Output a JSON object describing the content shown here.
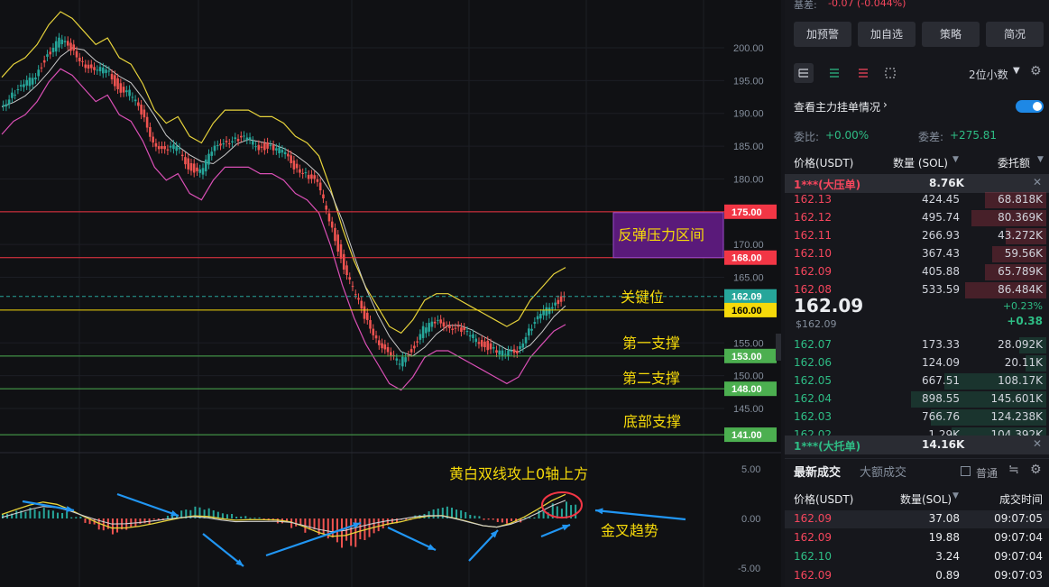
{
  "header": {
    "basis_label": "基差:",
    "basis_value": "-0.07 (-0.044%)"
  },
  "buttons": [
    "加预警",
    "加自选",
    "策略",
    "简况"
  ],
  "toolbar": {
    "decimals": "2位小数"
  },
  "orders_toggle": {
    "label": "查看主力挂单情况",
    "on": true
  },
  "stats": {
    "ratio_label": "委比:",
    "ratio_value": "+0.00%",
    "diff_label": "委差:",
    "diff_value": "+275.81"
  },
  "orderbook": {
    "headers": [
      "价格(USDT)",
      "数量 (SOL)",
      "委托额"
    ],
    "big_ask": {
      "label": "1***(大压单)",
      "qty": "8.76K"
    },
    "big_bid": {
      "label": "1***(大托单)",
      "qty": "14.16K"
    },
    "asks": [
      {
        "price": "162.13",
        "qty": "424.45",
        "amount": "68.818K",
        "fill": 0.45
      },
      {
        "price": "162.12",
        "qty": "495.74",
        "amount": "80.369K",
        "fill": 0.55
      },
      {
        "price": "162.11",
        "qty": "266.93",
        "amount": "43.272K",
        "fill": 0.3
      },
      {
        "price": "162.10",
        "qty": "367.43",
        "amount": "59.56K",
        "fill": 0.4
      },
      {
        "price": "162.09",
        "qty": "405.88",
        "amount": "65.789K",
        "fill": 0.45
      },
      {
        "price": "162.08",
        "qty": "533.59",
        "amount": "86.484K",
        "fill": 0.6
      }
    ],
    "mid": {
      "price": "162.09",
      "usd": "$162.09",
      "pct": "+0.23%",
      "change": "+0.38"
    },
    "bids": [
      {
        "price": "162.07",
        "qty": "173.33",
        "amount": "28.092K",
        "fill": 0.2
      },
      {
        "price": "162.06",
        "qty": "124.09",
        "amount": "20.11K",
        "fill": 0.15
      },
      {
        "price": "162.05",
        "qty": "667.51",
        "amount": "108.17K",
        "fill": 0.75
      },
      {
        "price": "162.04",
        "qty": "898.55",
        "amount": "145.601K",
        "fill": 1.0
      },
      {
        "price": "162.03",
        "qty": "766.76",
        "amount": "124.238K",
        "fill": 0.85
      },
      {
        "price": "162.02",
        "qty": "1.29K",
        "amount": "104.392K",
        "fill": 0.7
      }
    ]
  },
  "trades": {
    "tab_active": "最新成交",
    "tab_other": "大额成交",
    "filter_label": "普通",
    "headers": [
      "价格(USDT)",
      "数量(SOL)",
      "成交时间"
    ],
    "rows": [
      {
        "price": "162.09",
        "qty": "37.08",
        "time": "09:07:05",
        "side": "sell"
      },
      {
        "price": "162.09",
        "qty": "19.88",
        "time": "09:07:04",
        "side": "sell"
      },
      {
        "price": "162.10",
        "qty": "3.24",
        "time": "09:07:04",
        "side": "buy"
      },
      {
        "price": "162.09",
        "qty": "0.89",
        "time": "09:07:03",
        "side": "sell"
      }
    ]
  },
  "chart_data": {
    "type": "candlestick",
    "symbol_price_axis": [
      "200.00",
      "195.00",
      "190.00",
      "185.00",
      "180.00",
      "170.00",
      "165.00",
      "155.00",
      "150.00",
      "145.00"
    ],
    "macd_axis": [
      "5.00",
      "0.00",
      "-5.00"
    ],
    "ylim": [
      141,
      203
    ],
    "levels": [
      {
        "value": 175.0,
        "label": "175.00",
        "color": "#f23645"
      },
      {
        "value": 168.0,
        "label": "168.00",
        "color": "#f23645"
      },
      {
        "value": 162.09,
        "label": "162.09",
        "color": "#26a69a"
      },
      {
        "value": 160.0,
        "label": "160.00",
        "color": "#f5d90a"
      },
      {
        "value": 153.0,
        "label": "153.00",
        "color": "#4caf50"
      },
      {
        "value": 148.0,
        "label": "148.00",
        "color": "#4caf50"
      },
      {
        "value": 141.0,
        "label": "141.00",
        "color": "#4caf50"
      }
    ],
    "annotations": {
      "zone": "反弹压力区间",
      "key": "关键位",
      "support1": "第一支撑",
      "support2": "第二支撑",
      "support_bottom": "底部支撑",
      "macd_note": "黄白双线攻上0轴上方",
      "cross": "金叉趋势"
    },
    "price_path": [
      191,
      193,
      194,
      196,
      199,
      201,
      200,
      198,
      196,
      197,
      194,
      193,
      190,
      186,
      184,
      185,
      182,
      181,
      184,
      186,
      186,
      186,
      185,
      185,
      184,
      182,
      181,
      179,
      174,
      168,
      163,
      159,
      156,
      153,
      152,
      154,
      157,
      158,
      158,
      157,
      156,
      155,
      154,
      153,
      154,
      157,
      159,
      161,
      162
    ],
    "macd_hist": [
      0.5,
      0.8,
      1.1,
      1.3,
      0.9,
      0.2,
      -0.6,
      -1.2,
      -1.6,
      -1.3,
      -0.8,
      -0.2,
      0.4,
      0.9,
      1.2,
      1.1,
      0.7,
      0.3,
      0.1,
      -0.2,
      -0.5,
      -1.0,
      -1.8,
      -2.6,
      -3.1,
      -2.9,
      -2.2,
      -1.5,
      -0.8,
      -0.2,
      0.5,
      1.0,
      1.2,
      0.9,
      0.4,
      -0.2,
      -0.6,
      -0.4,
      0.1,
      0.8,
      1.6,
      2.2
    ]
  }
}
